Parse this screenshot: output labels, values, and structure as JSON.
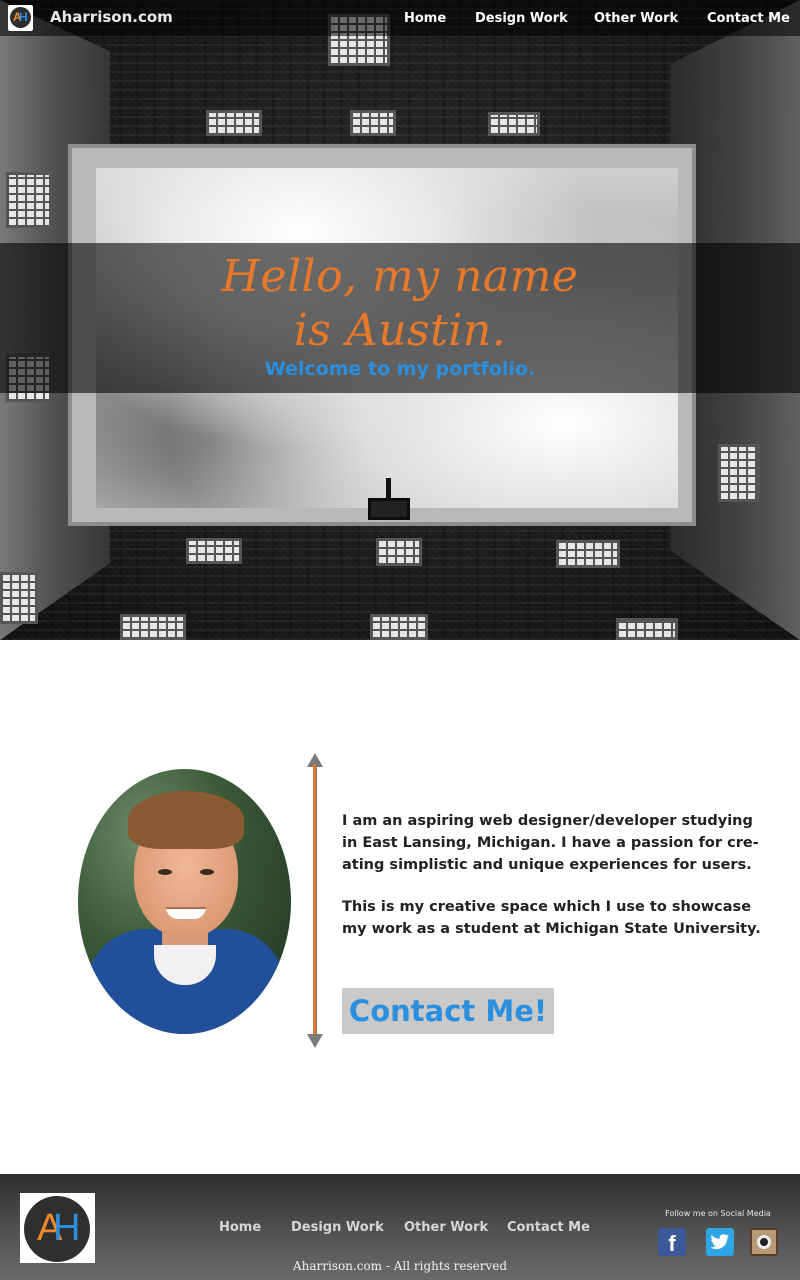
{
  "header": {
    "logo_letters": {
      "a": "A",
      "h": "H"
    },
    "site_title": "Aharrison.com",
    "nav": [
      {
        "label": "Home"
      },
      {
        "label": "Design Work"
      },
      {
        "label": "Other Work"
      },
      {
        "label": "Contact Me"
      }
    ]
  },
  "hero": {
    "title_line1": "Hello, my name",
    "title_line2": "is Austin.",
    "subtitle": "Welcome to my portfolio.",
    "colors": {
      "title": "#e8782a",
      "subtitle": "#2b8fe0"
    }
  },
  "about": {
    "portrait_icon": "person-photo",
    "bio_paragraph_1": [
      "I am an aspiring web designer/developer studying",
      "in East Lansing, Michigan. I have a passion for cre-",
      "ating simplistic and unique experiences for users."
    ],
    "bio_paragraph_2": [
      "This is my creative space which I use to showcase",
      "my work as a student at Michigan State University."
    ],
    "contact_button": "Contact Me!"
  },
  "footer": {
    "logo_letters": {
      "a": "A",
      "h": "H"
    },
    "nav": [
      {
        "label": "Home"
      },
      {
        "label": "Design Work"
      },
      {
        "label": "Other Work"
      },
      {
        "label": "Contact Me"
      }
    ],
    "copyright": "Aharrison.com - All rights reserved",
    "social_label": "Follow me on Social Media",
    "social": [
      {
        "name": "facebook-icon",
        "glyph": "f"
      },
      {
        "name": "twitter-icon"
      },
      {
        "name": "instagram-icon"
      }
    ]
  },
  "colors": {
    "accent_orange": "#e8782a",
    "accent_blue": "#2b8fe0",
    "footer_bg": "#4a4a4a"
  }
}
